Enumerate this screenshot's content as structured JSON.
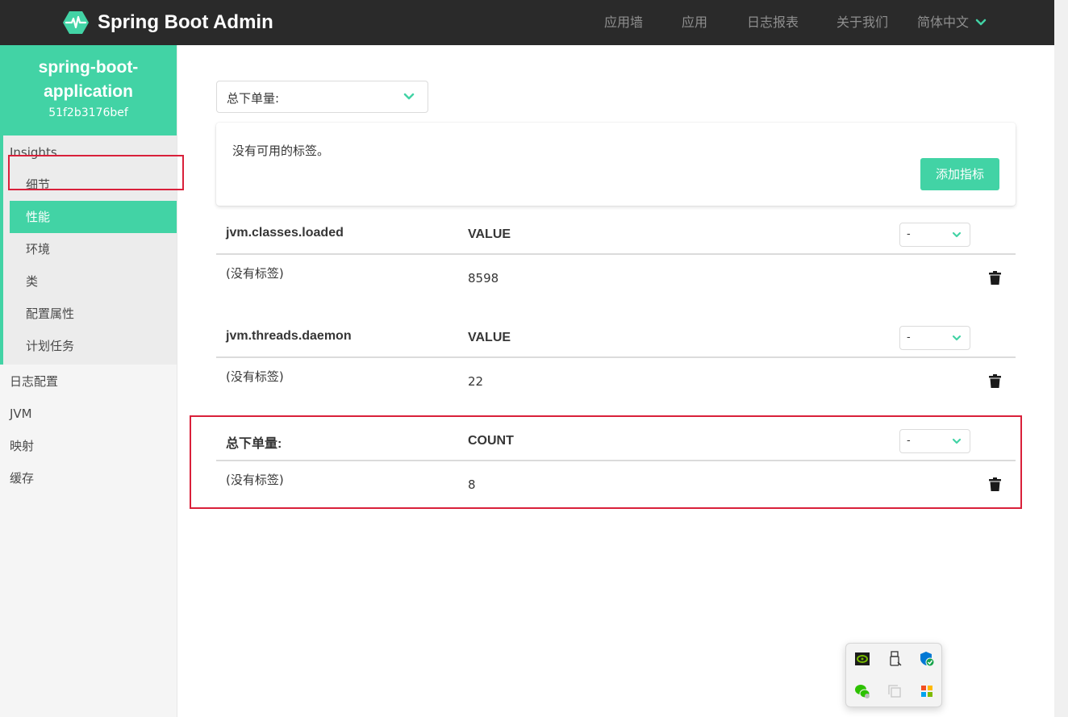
{
  "navbar": {
    "brand": "Spring Boot Admin",
    "items": [
      "应用墙",
      "应用",
      "日志报表",
      "关于我们"
    ],
    "language": "简体中文"
  },
  "sidebar": {
    "app_name": "spring-boot-application",
    "app_id": "51f2b3176bef",
    "group_label": "Insights",
    "group_items": [
      "细节",
      "性能",
      "环境",
      "类",
      "配置属性",
      "计划任务"
    ],
    "active_item": "性能",
    "items": [
      "日志配置",
      "JVM",
      "映射",
      "缓存"
    ]
  },
  "main": {
    "metric_select_value": "总下单量:",
    "no_tags_text": "没有可用的标签。",
    "add_metric_button": "添加指标",
    "metrics": [
      {
        "name": "jvm.classes.loaded",
        "statistic": "VALUE",
        "select_value": "-",
        "tags": "(没有标签)",
        "value": "8598"
      },
      {
        "name": "jvm.threads.daemon",
        "statistic": "VALUE",
        "select_value": "-",
        "tags": "(没有标签)",
        "value": "22"
      },
      {
        "name": "总下单量:",
        "statistic": "COUNT",
        "select_value": "-",
        "tags": "(没有标签)",
        "value": "8"
      }
    ]
  },
  "tray": {
    "icons": [
      "nvidia-icon",
      "usb-drive-icon",
      "security-shield-icon",
      "wechat-icon",
      "window-copy-icon",
      "color-app-icon"
    ]
  },
  "colors": {
    "accent": "#42d3a5",
    "navbar": "#2a2a2a",
    "highlight_border": "#d9203a"
  }
}
